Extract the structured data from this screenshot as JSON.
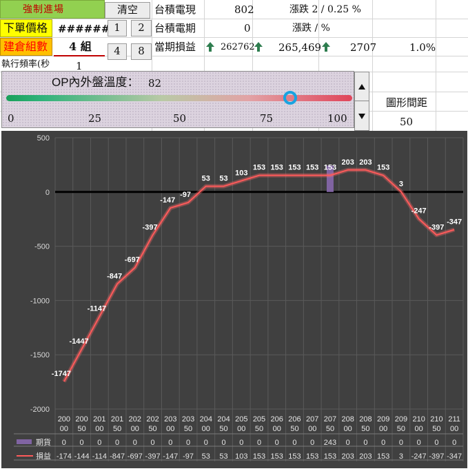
{
  "sheet": {
    "force_entry_label": "強制進場",
    "order_price_label": "下單價格",
    "order_price_value": "#######",
    "group_count_label": "建倉組數",
    "group_count_value": "4 組",
    "freq_label": "執行頻率(秒",
    "freq_value": "1",
    "clear_button": "清空",
    "btn_1": "1",
    "btn_2": "2",
    "btn_4": "4",
    "btn_8": "8",
    "taiex_now_label": "台積電現",
    "taiex_now_value": "802",
    "change_label": "漲跌 2 / 0.25 %",
    "taiex_period_label": "台積電期",
    "taiex_period_value": "0",
    "change_label_2": "漲跌 / %",
    "pnl_label": "當期損益",
    "pnl_value_1": "262762",
    "pnl_value_2": "265,469",
    "pnl_value_3": "2707",
    "pnl_percent": "1.0%",
    "chart_spacing_label": "圖形間距",
    "chart_spacing_value": "50"
  },
  "slider": {
    "title": "OP內外盤溫度：",
    "value": 82,
    "value_text": "82",
    "min": 0,
    "max": 100,
    "ticks": [
      "0",
      "25",
      "50",
      "75",
      "100"
    ]
  },
  "colors": {
    "force_entry_bg": "#92d050",
    "force_entry_fg": "#c00000",
    "label_yellow": "#ffff00",
    "label_orange": "#ffc000",
    "label_red_text": "#ff0000",
    "up_arrow": "#2e7d4f",
    "chart_bg": "#404040",
    "pnl_line": "#ff5a5a",
    "futures_bar": "#8064a2"
  },
  "chart_data": {
    "type": "line",
    "categories": [
      "20000",
      "20050",
      "20100",
      "20150",
      "20200",
      "20250",
      "20300",
      "20350",
      "20400",
      "20450",
      "20500",
      "20550",
      "20600",
      "20650",
      "20700",
      "20750",
      "20800",
      "20850",
      "20900",
      "20950",
      "21000",
      "21050",
      "21100"
    ],
    "x_tick_labels": [
      [
        "200",
        "00"
      ],
      [
        "200",
        "50"
      ],
      [
        "201",
        "00"
      ],
      [
        "201",
        "50"
      ],
      [
        "202",
        "00"
      ],
      [
        "202",
        "50"
      ],
      [
        "203",
        "00"
      ],
      [
        "203",
        "50"
      ],
      [
        "204",
        "00"
      ],
      [
        "204",
        "50"
      ],
      [
        "205",
        "00"
      ],
      [
        "205",
        "50"
      ],
      [
        "206",
        "00"
      ],
      [
        "206",
        "50"
      ],
      [
        "207",
        "00"
      ],
      [
        "207",
        "50"
      ],
      [
        "208",
        "00"
      ],
      [
        "208",
        "50"
      ],
      [
        "209",
        "00"
      ],
      [
        "209",
        "50"
      ],
      [
        "210",
        "00"
      ],
      [
        "210",
        "50"
      ],
      [
        "211",
        "00"
      ]
    ],
    "series": [
      {
        "name": "期貨",
        "type": "bar",
        "values": [
          0,
          0,
          0,
          0,
          0,
          0,
          0,
          0,
          0,
          0,
          0,
          0,
          0,
          0,
          0,
          243,
          0,
          0,
          0,
          0,
          0,
          0,
          0
        ]
      },
      {
        "name": "損益",
        "type": "line",
        "values": [
          -1747,
          -1447,
          -1147,
          -847,
          -697,
          -397,
          -147,
          -97,
          53,
          53,
          103,
          153,
          153,
          153,
          153,
          153,
          203,
          203,
          153,
          3,
          -247,
          -397,
          -347
        ]
      }
    ],
    "data_labels": [
      "-1747",
      "-1447",
      "-1147",
      "-847",
      "-697",
      "-397",
      "-147",
      "-97",
      "53",
      "53",
      "103",
      "153",
      "153",
      "153",
      "153",
      "153",
      "203",
      "203",
      "153",
      "3",
      "-247",
      "-397",
      "-347"
    ],
    "table_rows": [
      {
        "name": "期貨",
        "cells": [
          "0",
          "0",
          "0",
          "0",
          "0",
          "0",
          "0",
          "0",
          "0",
          "0",
          "0",
          "0",
          "0",
          "0",
          "0",
          "243",
          "0",
          "0",
          "0",
          "0",
          "0",
          "0",
          "0"
        ]
      },
      {
        "name": "損益",
        "cells": [
          "-174",
          "-144",
          "-114",
          "-847",
          "-697",
          "-397",
          "-147",
          "-97",
          "53",
          "53",
          "103",
          "153",
          "153",
          "153",
          "153",
          "153",
          "203",
          "203",
          "153",
          "3",
          "-247",
          "-397",
          "-347"
        ]
      }
    ],
    "y_ticks": [
      "500",
      "0",
      "-500",
      "-1000",
      "-1500",
      "-2000"
    ],
    "ylim": [
      -2000,
      500
    ],
    "grid": true,
    "legend": "data-table"
  }
}
